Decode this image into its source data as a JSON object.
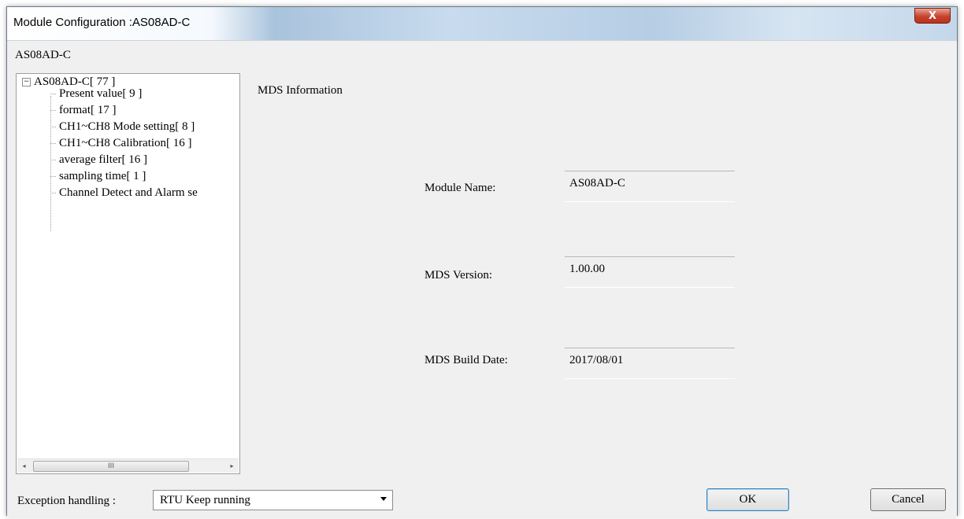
{
  "window": {
    "title": "Module Configuration :AS08AD-C",
    "close_glyph": "X"
  },
  "module_label": "AS08AD-C",
  "tree": {
    "expander_glyph": "−",
    "root_label": "AS08AD-C[ 77 ]",
    "items": [
      {
        "label": "Present value[ 9 ]"
      },
      {
        "label": "format[ 17 ]"
      },
      {
        "label": "CH1~CH8 Mode setting[ 8 ]"
      },
      {
        "label": "CH1~CH8 Calibration[ 16 ]"
      },
      {
        "label": "average filter[ 16 ]"
      },
      {
        "label": "sampling time[ 1 ]"
      },
      {
        "label": "Channel Detect and Alarm se"
      }
    ],
    "scroll_left_glyph": "◂",
    "scroll_right_glyph": "▸",
    "scroll_thumb_grip": "III"
  },
  "mds": {
    "section_title": "MDS Information",
    "fields": [
      {
        "label": "Module Name:",
        "value": "AS08AD-C"
      },
      {
        "label": "MDS Version:",
        "value": "1.00.00"
      },
      {
        "label": "MDS Build Date:",
        "value": "2017/08/01"
      }
    ]
  },
  "footer": {
    "exception_label": "Exception handling :",
    "exception_value": "RTU Keep running",
    "ok_label": "OK",
    "cancel_label": "Cancel"
  }
}
